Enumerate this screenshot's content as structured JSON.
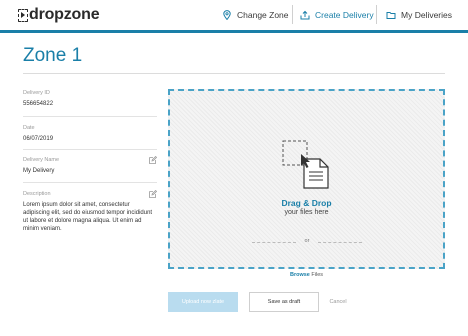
{
  "header": {
    "logo_text": "dropzone",
    "nav": [
      {
        "label": "Change Zone",
        "icon": "location-pin-icon",
        "active": false
      },
      {
        "label": "Create Delivery",
        "icon": "upload-tray-icon",
        "active": true
      },
      {
        "label": "My Deliveries",
        "icon": "folder-icon",
        "active": false
      }
    ],
    "accent_color": "#1a7fa8"
  },
  "page": {
    "title": "Zone 1"
  },
  "details": {
    "delivery_id": {
      "label": "Delivery ID",
      "value": "556654822"
    },
    "date": {
      "label": "Date",
      "value": "06/07/2019"
    },
    "delivery_name": {
      "label": "Delivery Name",
      "value": "My Delivery"
    },
    "description": {
      "label": "Description",
      "value": "Lorem ipsum dolor sit amet, consectetur adipiscing elit, sed do eiusmod tempor incididunt ut labore et dolore magna aliqua. Ut enim ad minim veniam."
    }
  },
  "dropzone": {
    "title": "Drag & Drop",
    "subtitle": "your files here",
    "or_text": "or",
    "browse_link": "Browse",
    "browse_suffix": " Files"
  },
  "actions": {
    "upload_label": "Upload now zlate",
    "draft_label": "Save as draft",
    "cancel_label": "Cancel"
  }
}
